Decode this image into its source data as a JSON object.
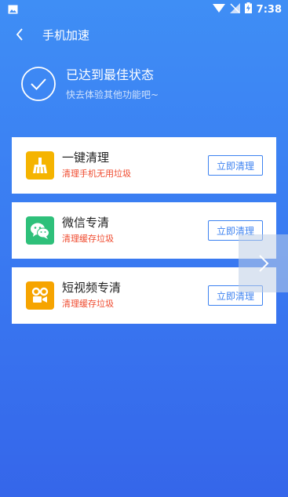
{
  "status_bar": {
    "time": "7:38"
  },
  "header": {
    "title": "手机加速"
  },
  "result": {
    "title": "已达到最佳状态",
    "subtitle": "快去体验其他功能吧~"
  },
  "cards": [
    {
      "title": "一键清理",
      "subtitle": "清理手机无用垃圾",
      "button": "立即清理",
      "icon": "broom-icon",
      "icon_color": "#f5b400"
    },
    {
      "title": "微信专清",
      "subtitle": "清理缓存垃圾",
      "button": "立即清理",
      "icon": "wechat-icon",
      "icon_color": "#2ec07a"
    },
    {
      "title": "短视频专清",
      "subtitle": "清理缓存垃圾",
      "button": "立即清理",
      "icon": "video-app-icon",
      "icon_color": "#f6a400"
    }
  ],
  "colors": {
    "accent": "#3d82f0",
    "warning_text": "#ef4a2e"
  }
}
